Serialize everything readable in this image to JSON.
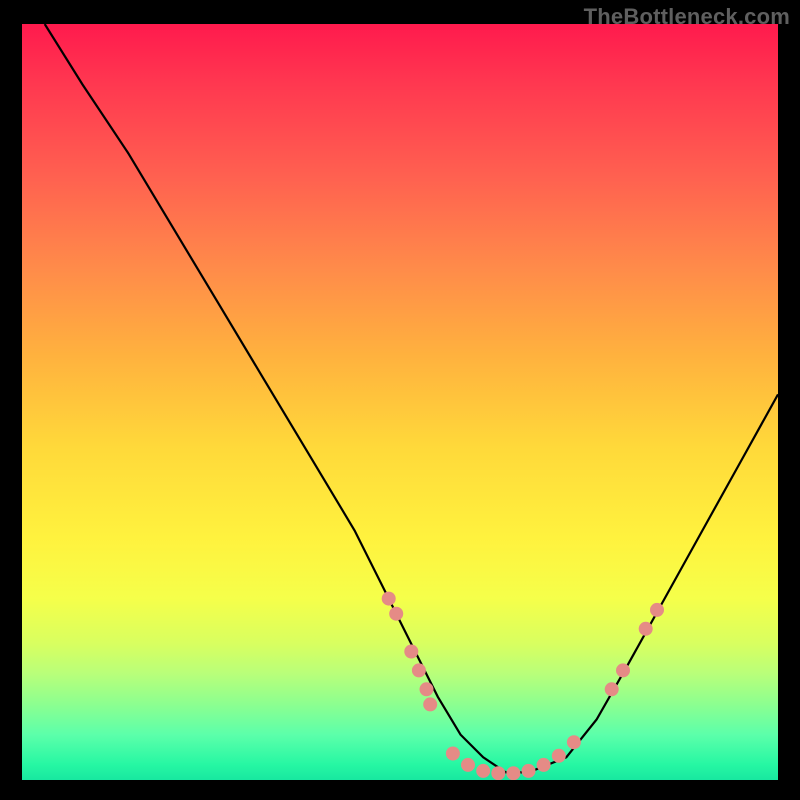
{
  "watermark": "TheBottleneck.com",
  "chart_data": {
    "type": "line",
    "title": "",
    "xlabel": "",
    "ylabel": "",
    "xlim": [
      0,
      100
    ],
    "ylim": [
      0,
      100
    ],
    "series": [
      {
        "name": "curve",
        "x": [
          3,
          8,
          14,
          20,
          26,
          32,
          38,
          44,
          48,
          52,
          55,
          58,
          61,
          64,
          67,
          72,
          76,
          80,
          85,
          90,
          95,
          100
        ],
        "values": [
          100,
          92,
          83,
          73,
          63,
          53,
          43,
          33,
          25,
          17,
          11,
          6,
          3,
          1,
          1,
          3,
          8,
          15,
          24,
          33,
          42,
          51
        ]
      }
    ],
    "markers": [
      {
        "x": 48.5,
        "y": 24.0
      },
      {
        "x": 49.5,
        "y": 22.0
      },
      {
        "x": 51.5,
        "y": 17.0
      },
      {
        "x": 52.5,
        "y": 14.5
      },
      {
        "x": 53.5,
        "y": 12.0
      },
      {
        "x": 54.0,
        "y": 10.0
      },
      {
        "x": 57.0,
        "y": 3.5
      },
      {
        "x": 59.0,
        "y": 2.0
      },
      {
        "x": 61.0,
        "y": 1.2
      },
      {
        "x": 63.0,
        "y": 0.9
      },
      {
        "x": 65.0,
        "y": 0.9
      },
      {
        "x": 67.0,
        "y": 1.2
      },
      {
        "x": 69.0,
        "y": 2.0
      },
      {
        "x": 71.0,
        "y": 3.2
      },
      {
        "x": 73.0,
        "y": 5.0
      },
      {
        "x": 78.0,
        "y": 12.0
      },
      {
        "x": 79.5,
        "y": 14.5
      },
      {
        "x": 82.5,
        "y": 20.0
      },
      {
        "x": 84.0,
        "y": 22.5
      }
    ],
    "annotations": []
  }
}
